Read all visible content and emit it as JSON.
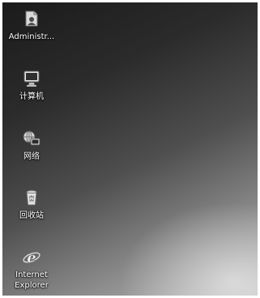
{
  "desktop": {
    "icons": [
      {
        "label": "Administr...",
        "icon": "user-folder-icon"
      },
      {
        "label": "计算机",
        "icon": "computer-icon"
      },
      {
        "label": "网络",
        "icon": "network-icon"
      },
      {
        "label": "回收站",
        "icon": "recycle-bin-icon"
      },
      {
        "label": "Internet\nExplorer",
        "icon": "internet-explorer-icon"
      }
    ]
  }
}
